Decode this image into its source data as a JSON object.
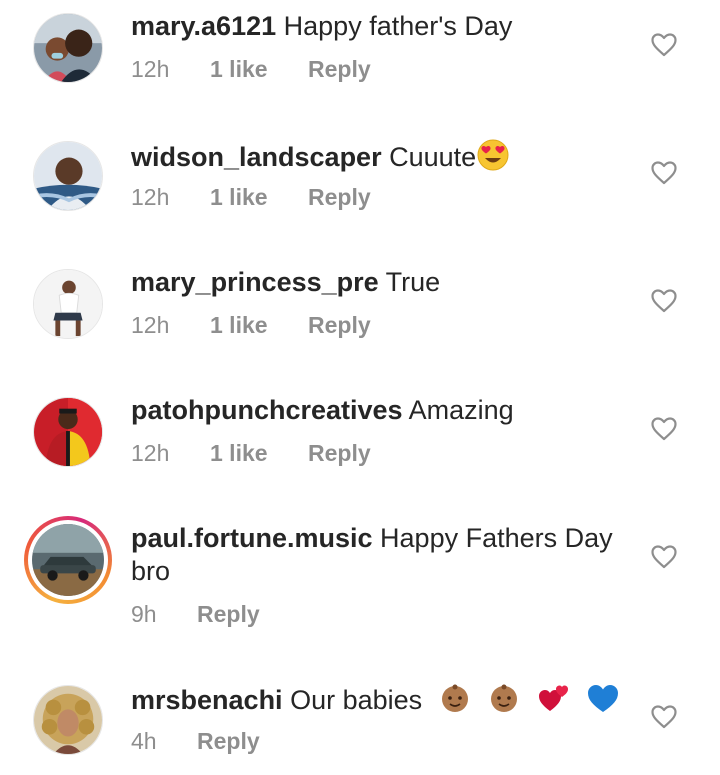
{
  "comments": [
    {
      "username": "mary.a6121",
      "text": "Happy father's Day",
      "time": "12h",
      "likes": "1 like",
      "reply": "Reply",
      "avatar": "couple-selfie-avatar"
    },
    {
      "username": "widson_landscaper",
      "text": "Cuuute",
      "emoji": "heart-eyes-emoji",
      "time": "12h",
      "likes": "1 like",
      "reply": "Reply",
      "avatar": "man-portrait-avatar"
    },
    {
      "username": "mary_princess_pre",
      "text": "True",
      "time": "12h",
      "likes": "1 like",
      "reply": "Reply",
      "avatar": "woman-seated-avatar"
    },
    {
      "username": "patohpunchcreatives",
      "text": "Amazing",
      "time": "12h",
      "likes": "1 like",
      "reply": "Reply",
      "avatar": "red-yellow-jacket-avatar"
    },
    {
      "username": "paul.fortune.music",
      "text_line1": "Happy Fathers Day",
      "text_line2": "bro",
      "time": "9h",
      "reply": "Reply",
      "avatar": "car-story-avatar"
    },
    {
      "username": "mrsbenachi",
      "text": "Our babies",
      "emojis": [
        "baby-emoji",
        "baby-emoji",
        "two-hearts-emoji",
        "blue-heart-emoji"
      ],
      "time": "4h",
      "reply": "Reply",
      "avatar": "curly-hair-woman-avatar"
    }
  ],
  "colors": {
    "username": "#262626",
    "meta": "#8e8e8e",
    "heart_outline": "#8e8e8e",
    "story_ring_start": "#f5b13f",
    "story_ring_end": "#d62a7a"
  }
}
